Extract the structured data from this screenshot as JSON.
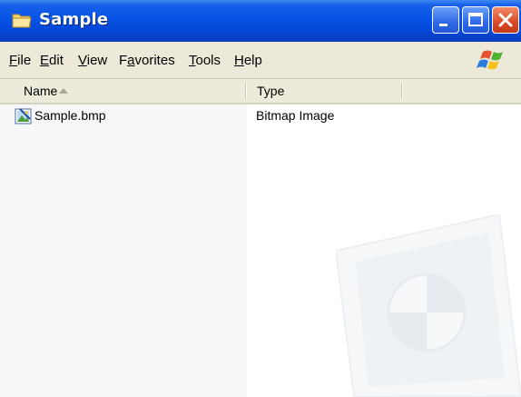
{
  "window": {
    "title": "Sample",
    "buttons": {
      "minimize": "minimize",
      "maximize": "maximize",
      "close": "close"
    }
  },
  "menu": {
    "items": [
      {
        "label": "File",
        "mnemonic": "F",
        "rest": "ile"
      },
      {
        "label": "Edit",
        "mnemonic": "E",
        "rest": "dit"
      },
      {
        "label": "View",
        "mnemonic": "V",
        "rest": "iew"
      },
      {
        "label": "Favorites",
        "pre": "F",
        "mnemonic": "a",
        "rest": "vorites"
      },
      {
        "label": "Tools",
        "mnemonic": "T",
        "rest": "ools"
      },
      {
        "label": "Help",
        "mnemonic": "H",
        "rest": "elp"
      }
    ]
  },
  "columns": {
    "name": "Name",
    "type": "Type"
  },
  "files": [
    {
      "name": "Sample.bmp",
      "type": "Bitmap Image",
      "icon": "bitmap-file-icon"
    }
  ],
  "colors": {
    "titlebar": "#0553e4",
    "menubar": "#ece9d8",
    "name_column_bg": "#f7f7f7"
  }
}
